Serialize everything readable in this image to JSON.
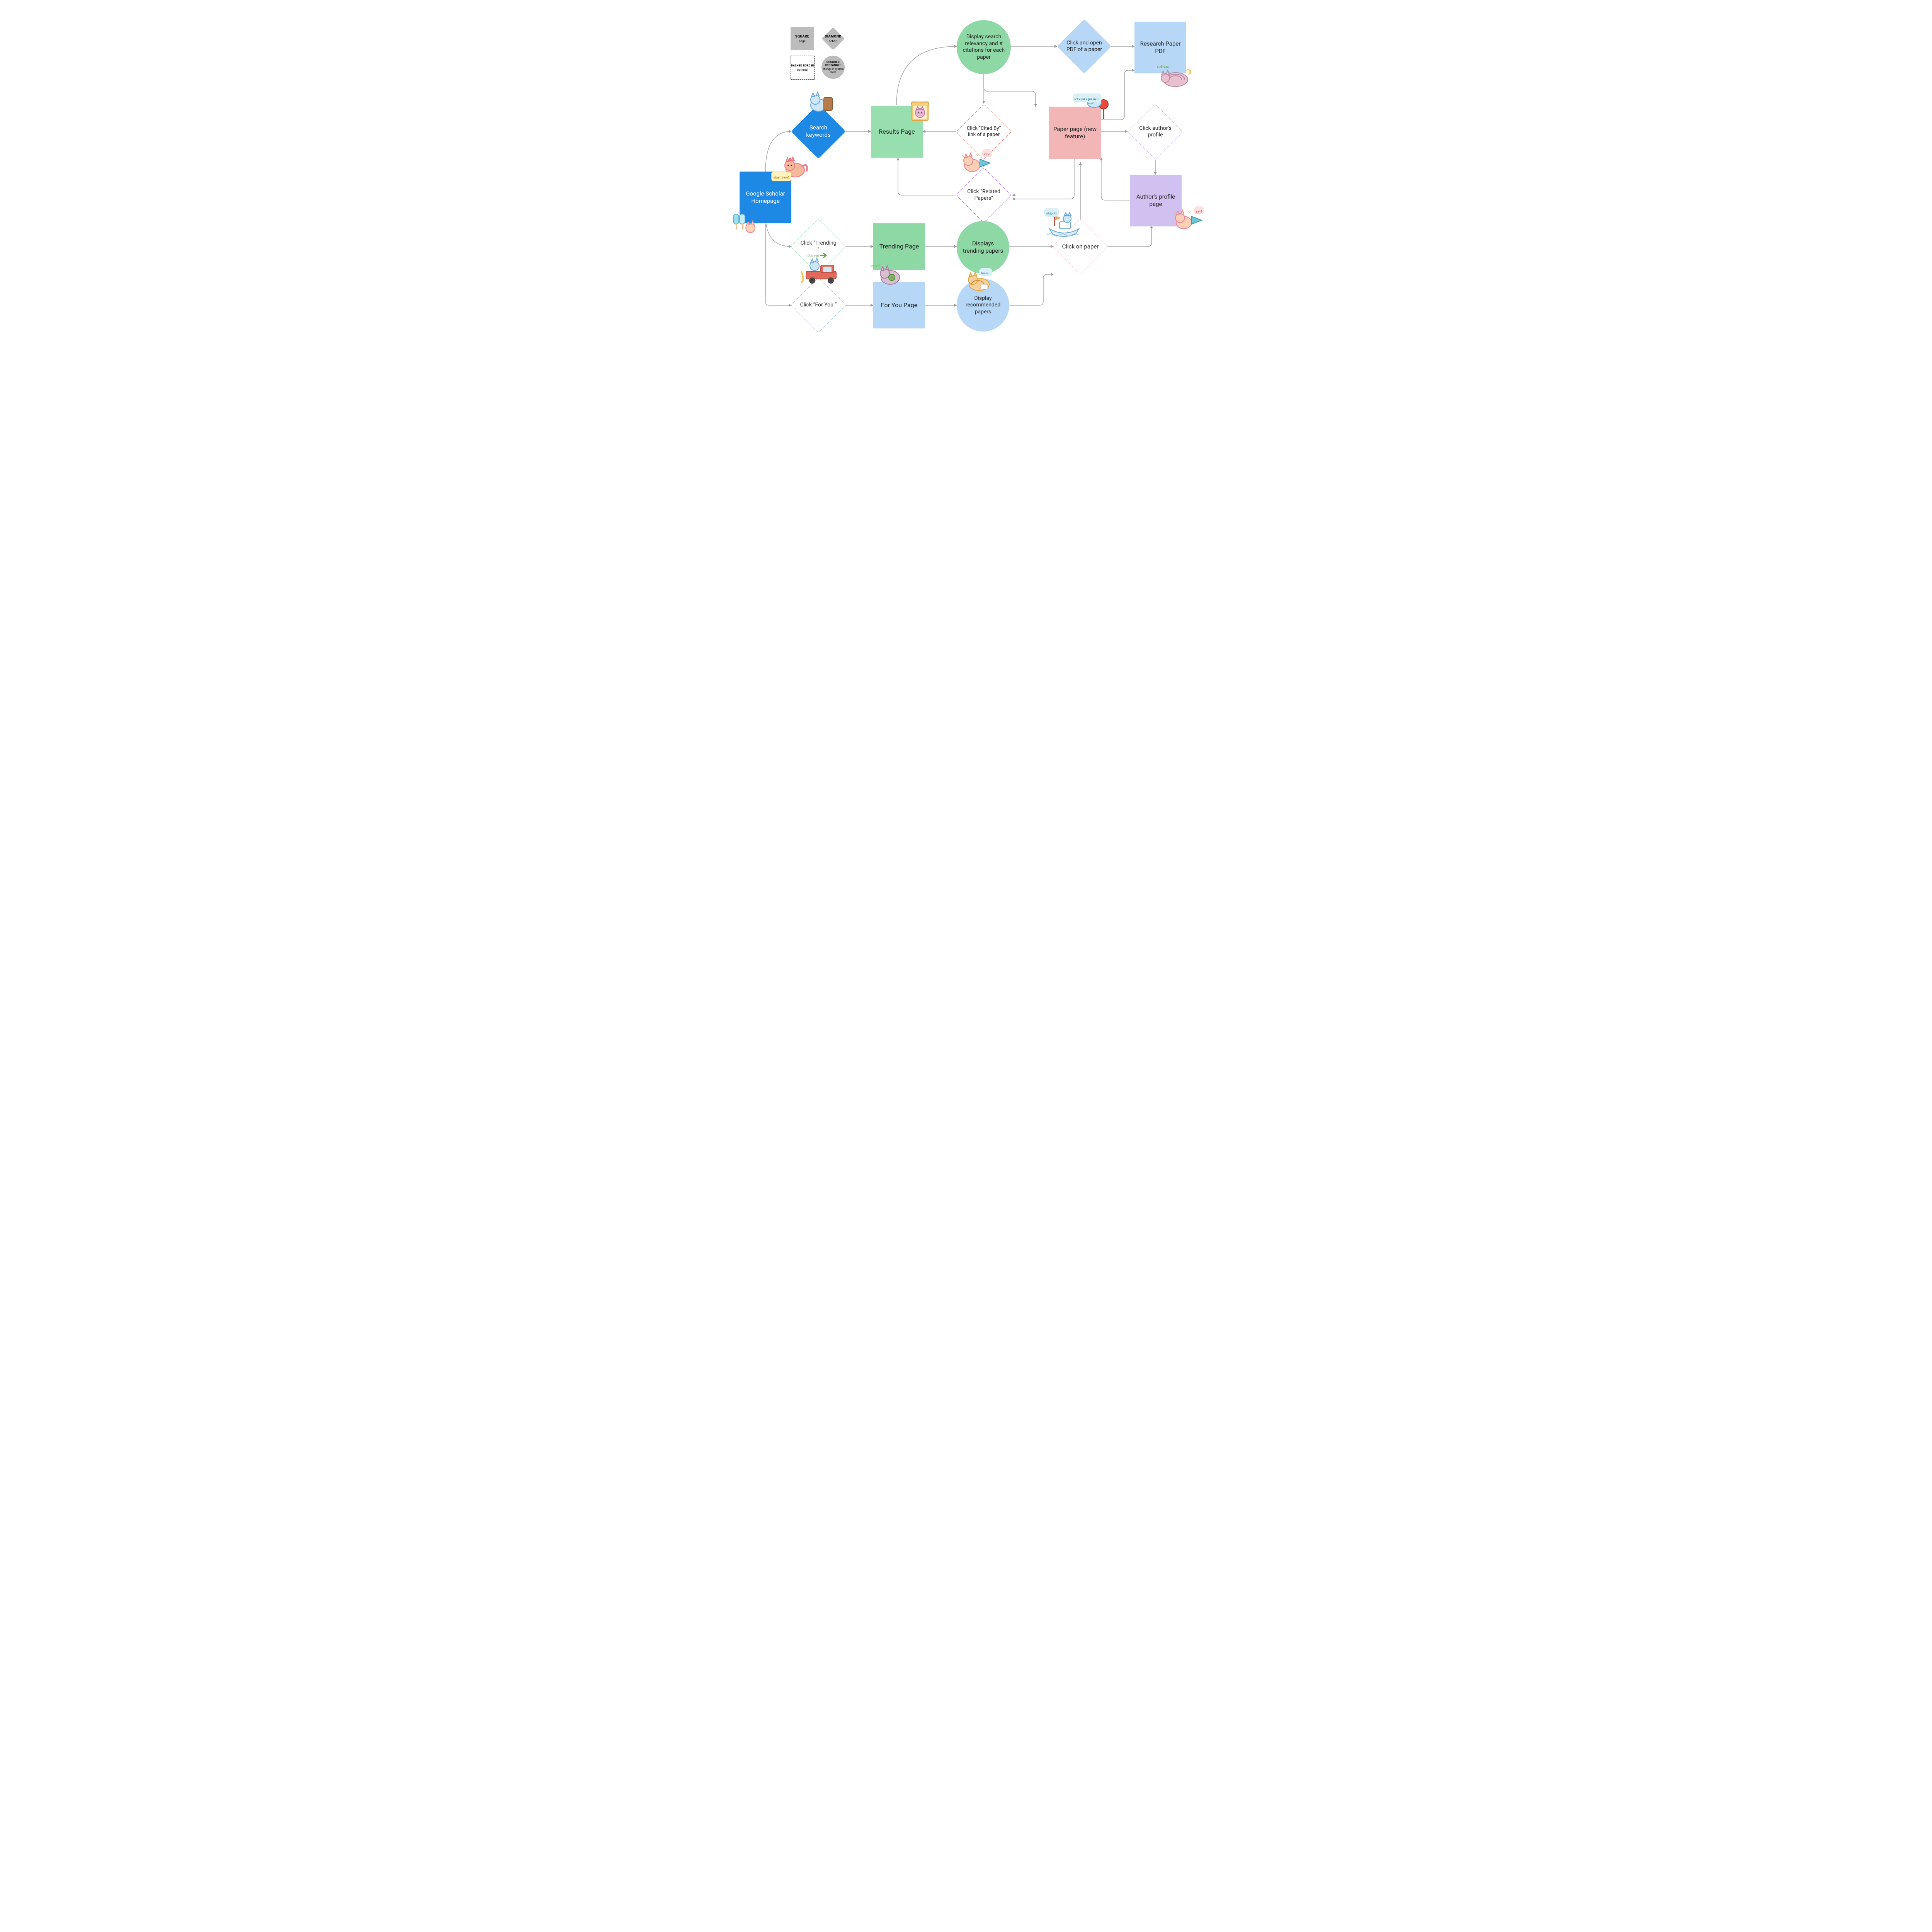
{
  "legend": {
    "square": {
      "title": "SQUARE",
      "sub": "page"
    },
    "diamond": {
      "title": "DIAMOND",
      "sub": "action"
    },
    "dashed": {
      "title": "DASHED BORDER",
      "sub": "optional"
    },
    "rounded": {
      "title": "ROUNDED RECTANGLE",
      "sub": "change in system state"
    }
  },
  "nodes": {
    "homepage": "Google Scholar Homepage",
    "searchKeywords": "Search keywords",
    "resultsPage": "Results Page",
    "searchRelevancy": "Display search relevancy and # citations for each paper",
    "citedBy": "Click “Cited By” link of a paper",
    "relatedPapers": "Click “Related Papers”",
    "clickTrending": "Click “Trending ”",
    "clickForYou": "Click “For You ”",
    "trendingPage": "Trending Page",
    "forYouPage": "For You Page",
    "displaysTrending": "Displays trending papers",
    "displayRecommended": "Display recommended papers",
    "clickOnPaper": "Click on paper",
    "paperPage": "Paper page (new feature)",
    "openPdf": "Click and open PDF of a paper",
    "researchPdf": "Research Paper PDF",
    "clickAuthor": "Click author's profile",
    "authorPage": "Author's profile page"
  },
  "stickers": {
    "startHere": "start here!",
    "thisWay": "this way",
    "yay": "yay!",
    "sweet": "sweet!",
    "hmm": "hmm..",
    "shipIt": "ship it!",
    "pinIt": "let's put a pin in it!",
    "ctrlZ": "ctrl+zzz"
  },
  "colors": {
    "blue": "#1e88e5",
    "blueLight": "#b6d7f6",
    "green": "#98dfaf",
    "greenMid": "#8ed8a5",
    "pink": "#f2b6b6",
    "purple": "#d0c1f0",
    "gray": "#bcbcbc",
    "arrow": "#9a9a9a",
    "purpleDash": "#8a2be2",
    "redDash": "#e74c3c",
    "greenDash": "#59c98b",
    "blueDash": "#7aa7e6",
    "pinkDash": "#efb0b0"
  }
}
